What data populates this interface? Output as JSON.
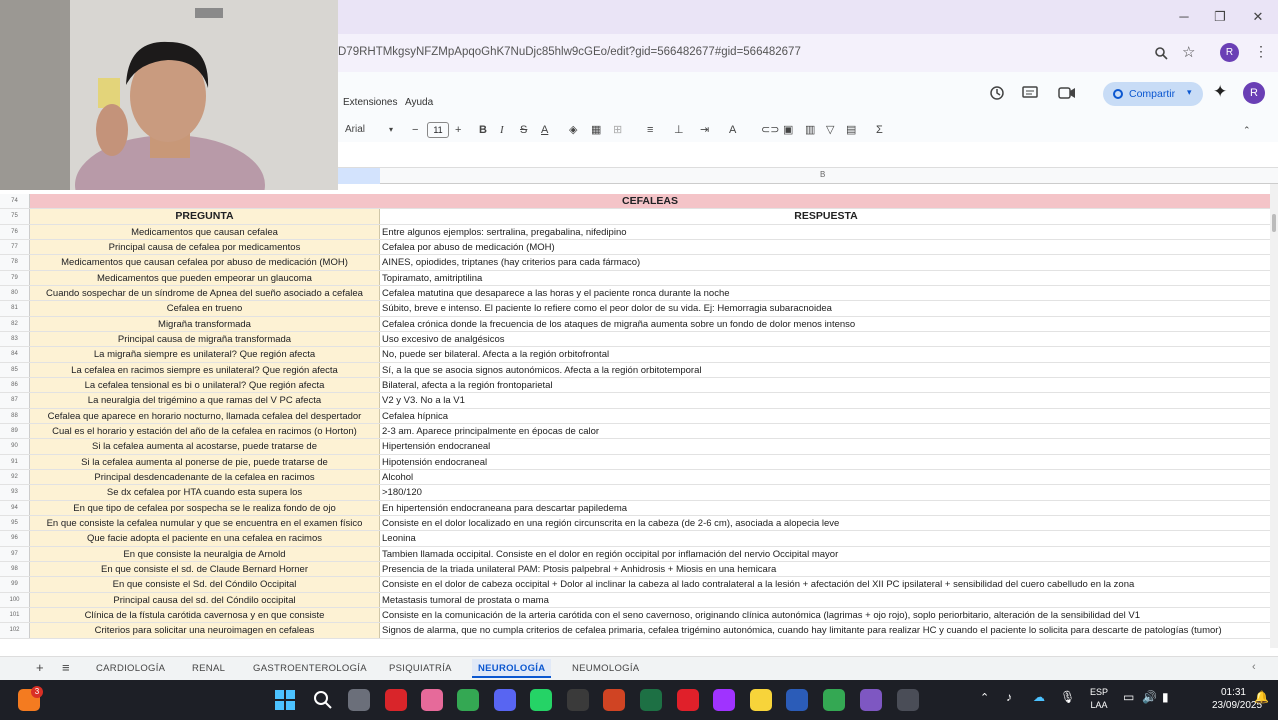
{
  "window": {
    "minimize": "─",
    "restore": "❐",
    "close": "✕"
  },
  "browser": {
    "url": "D79RHTMkgsyNFZMpApqoGhK7NuDjc85hlw9cGEo/edit?gid=566482677#gid=566482677",
    "avatar": "R"
  },
  "docs_menu": {
    "extensions": "Extensiones",
    "help": "Ayuda",
    "share": "Compartir",
    "avatar": "R"
  },
  "toolbar": {
    "font": "Arial",
    "font_size": "11"
  },
  "sheet": {
    "title": "CEFALEAS",
    "header": {
      "q": "PREGUNTA",
      "a": "RESPUESTA"
    },
    "title_row": "74",
    "header_row": "75",
    "rows": [
      {
        "n": "76",
        "q": "Medicamentos que causan cefalea",
        "a": "Entre algunos ejemplos: sertralina, pregabalina, nifedipino"
      },
      {
        "n": "77",
        "q": "Principal causa de cefalea por medicamentos",
        "a": "Cefalea por abuso de medicación (MOH)"
      },
      {
        "n": "78",
        "q": "Medicamentos que causan cefalea por abuso de medicación (MOH)",
        "a": "AINES, opiodides, triptanes (hay criterios para cada fármaco)"
      },
      {
        "n": "79",
        "q": "Medicamentos que pueden empeorar un glaucoma",
        "a": "Topiramato, amitriptilina"
      },
      {
        "n": "80",
        "q": "Cuando sospechar de un síndrome de Apnea del sueño asociado a cefalea",
        "a": "Cefalea matutina que desaparece a las horas y el paciente ronca durante la noche"
      },
      {
        "n": "81",
        "q": "Cefalea en trueno",
        "a": "Súbito, breve e intenso. El paciente lo refiere como el peor dolor de su vida. Ej: Hemorragia subaracnoidea"
      },
      {
        "n": "82",
        "q": "Migraña transformada",
        "a": "Cefalea crónica donde la frecuencia de los ataques de migraña aumenta sobre un fondo de dolor menos intenso"
      },
      {
        "n": "83",
        "q": "Principal causa de migraña transformada",
        "a": "Uso excesivo de analgésicos"
      },
      {
        "n": "84",
        "q": "La migraña siempre es unilateral? Que región afecta",
        "a": "No, puede ser bilateral. Afecta a la región orbitofrontal"
      },
      {
        "n": "85",
        "q": "La cefalea en racimos siempre es unilateral? Que región afecta",
        "a": "Sí, a la que se asocia signos autonómicos. Afecta a la región orbitotemporal"
      },
      {
        "n": "86",
        "q": "La cefalea tensional es bi o unilateral? Que región afecta",
        "a": "Bilateral, afecta a la región frontoparietal"
      },
      {
        "n": "87",
        "q": "La neuralgia del trigémino a que ramas del V PC afecta",
        "a": "V2 y V3. No a la V1"
      },
      {
        "n": "88",
        "q": "Cefalea que aparece en horario nocturno, llamada cefalea del despertador",
        "a": "Cefalea hípnica"
      },
      {
        "n": "89",
        "q": "Cual es el horario y estación del año de la cefalea en racimos (o Horton)",
        "a": "2-3 am. Aparece principalmente en épocas de calor"
      },
      {
        "n": "90",
        "q": "Si la cefalea aumenta al acostarse, puede tratarse de",
        "a": "Hipertensión endocraneal"
      },
      {
        "n": "91",
        "q": "Si la cefalea aumenta al ponerse de pie, puede tratarse de",
        "a": "Hipotensión endocraneal"
      },
      {
        "n": "92",
        "q": "Principal desdencadenante de la cefalea en racimos",
        "a": "Alcohol"
      },
      {
        "n": "93",
        "q": "Se dx cefalea por HTA cuando esta supera los",
        "a": ">180/120"
      },
      {
        "n": "94",
        "q": "En que tipo de cefalea por sospecha se le realiza fondo de ojo",
        "a": "En hipertensión endocraneana para descartar papiledema"
      },
      {
        "n": "95",
        "q": "En que consiste la cefalea numular y que se encuentra en el examen físico",
        "a": "Consiste en el dolor localizado en una región circunscrita en la cabeza (de 2-6 cm), asociada a alopecia leve"
      },
      {
        "n": "96",
        "q": "Que facie adopta el paciente en una cefalea en racimos",
        "a": "Leonina"
      },
      {
        "n": "97",
        "q": "En que consiste la neuralgia de Arnold",
        "a": "Tambien llamada occipital. Consiste en el dolor en región occipital por inflamación del nervio Occipital mayor"
      },
      {
        "n": "98",
        "q": "En que consiste el sd. de Claude Bernard Horner",
        "a": "Presencia de la triada unilateral PAM: Ptosis palpebral + Anhidrosis + Miosis en una hemicara"
      },
      {
        "n": "99",
        "q": "En que consiste el Sd. del Cóndilo Occipital",
        "a": "Consiste en el dolor de cabeza occipital + Dolor al inclinar la cabeza al lado contralateral a la lesión + afectación del XII PC ipsilateral + sensibilidad del cuero cabelludo en la zona"
      },
      {
        "n": "100",
        "q": "Principal causa del sd. del Cóndilo occipital",
        "a": "Metastasis tumoral de prostata o mama"
      },
      {
        "n": "101",
        "q": "Clínica de la fístula carótida cavernosa y en que consiste",
        "a": "Consiste en la comunicación de la arteria carótida con el seno cavernoso, originando clínica autonómica (lagrimas + ojo rojo), soplo periorbitario, alteración de la sensibilidad del V1"
      },
      {
        "n": "102",
        "q": "Criterios para solicitar una neuroimagen en cefaleas",
        "a": "Signos de alarma, que no cumpla criterios de cefalea primaria, cefalea trigémino autonómica, cuando hay limitante para realizar HC y cuando el paciente lo solicita para descarte de patologías (tumor)"
      }
    ]
  },
  "sheet_tabs": {
    "add": "+",
    "list": "≡",
    "tabs": [
      "CARDIOLOGÍA",
      "RENAL",
      "GASTROENTEROLOGÍA",
      "PSIQUIATRÍA",
      "NEUROLOGÍA",
      "NEUMOLOGÍA"
    ],
    "active": "NEUROLOGÍA"
  },
  "taskbar": {
    "lang1": "ESP",
    "lang2": "LAA",
    "time": "01:31",
    "date": "23/09/2025",
    "notif_badge": "3"
  },
  "colors": {
    "question_bg": "#fdf2d4",
    "title_bg": "#f4c4c8",
    "accent": "#0b57d0"
  }
}
